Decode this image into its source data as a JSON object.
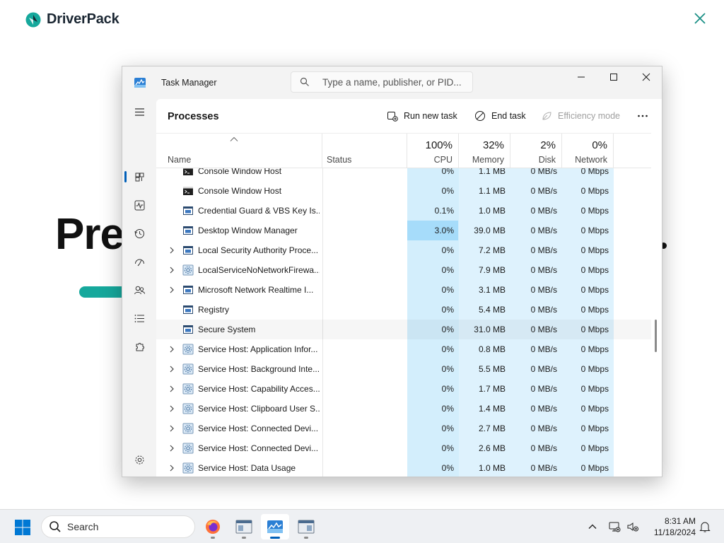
{
  "installer": {
    "brand": "DriverPack",
    "heading_fragment": "Pre"
  },
  "window": {
    "title": "Task Manager",
    "search_placeholder": "Type a name, publisher, or PID..."
  },
  "toolbar": {
    "section_title": "Processes",
    "run_new_task": "Run new task",
    "end_task": "End task",
    "efficiency_mode": "Efficiency mode"
  },
  "columns": {
    "name": "Name",
    "status": "Status",
    "cpu": {
      "percent": "100%",
      "label": "CPU"
    },
    "memory": {
      "percent": "32%",
      "label": "Memory"
    },
    "disk": {
      "percent": "2%",
      "label": "Disk"
    },
    "network": {
      "percent": "0%",
      "label": "Network"
    }
  },
  "processes": [
    {
      "name": "Console Window Host",
      "icon": "console-icon",
      "expandable": false,
      "cpu": "0%",
      "memory": "1.1 MB",
      "disk": "0 MB/s",
      "network": "0 Mbps"
    },
    {
      "name": "Console Window Host",
      "icon": "console-icon",
      "expandable": false,
      "cpu": "0%",
      "memory": "1.1 MB",
      "disk": "0 MB/s",
      "network": "0 Mbps"
    },
    {
      "name": "Credential Guard & VBS Key Is...",
      "icon": "window-icon",
      "expandable": false,
      "cpu": "0.1%",
      "memory": "1.0 MB",
      "disk": "0 MB/s",
      "network": "0 Mbps"
    },
    {
      "name": "Desktop Window Manager",
      "icon": "window-icon",
      "expandable": false,
      "cpu": "3.0%",
      "memory": "39.0 MB",
      "disk": "0 MB/s",
      "network": "0 Mbps",
      "cpu_highlight": true
    },
    {
      "name": "Local Security Authority Proce...",
      "icon": "window-icon",
      "expandable": true,
      "cpu": "0%",
      "memory": "7.2 MB",
      "disk": "0 MB/s",
      "network": "0 Mbps"
    },
    {
      "name": "LocalServiceNoNetworkFirewa...",
      "icon": "gear-icon",
      "expandable": true,
      "cpu": "0%",
      "memory": "7.9 MB",
      "disk": "0 MB/s",
      "network": "0 Mbps"
    },
    {
      "name": "Microsoft Network Realtime I...",
      "icon": "window-icon",
      "expandable": true,
      "cpu": "0%",
      "memory": "3.1 MB",
      "disk": "0 MB/s",
      "network": "0 Mbps"
    },
    {
      "name": "Registry",
      "icon": "window-icon",
      "expandable": false,
      "cpu": "0%",
      "memory": "5.4 MB",
      "disk": "0 MB/s",
      "network": "0 Mbps"
    },
    {
      "name": "Secure System",
      "icon": "window-icon",
      "expandable": false,
      "cpu": "0%",
      "memory": "31.0 MB",
      "disk": "0 MB/s",
      "network": "0 Mbps",
      "hover": true
    },
    {
      "name": "Service Host: Application Infor...",
      "icon": "gear-icon",
      "expandable": true,
      "cpu": "0%",
      "memory": "0.8 MB",
      "disk": "0 MB/s",
      "network": "0 Mbps"
    },
    {
      "name": "Service Host: Background Inte...",
      "icon": "gear-icon",
      "expandable": true,
      "cpu": "0%",
      "memory": "5.5 MB",
      "disk": "0 MB/s",
      "network": "0 Mbps"
    },
    {
      "name": "Service Host: Capability Acces...",
      "icon": "gear-icon",
      "expandable": true,
      "cpu": "0%",
      "memory": "1.7 MB",
      "disk": "0 MB/s",
      "network": "0 Mbps"
    },
    {
      "name": "Service Host: Clipboard User S...",
      "icon": "gear-icon",
      "expandable": true,
      "cpu": "0%",
      "memory": "1.4 MB",
      "disk": "0 MB/s",
      "network": "0 Mbps"
    },
    {
      "name": "Service Host: Connected Devi...",
      "icon": "gear-icon",
      "expandable": true,
      "cpu": "0%",
      "memory": "2.7 MB",
      "disk": "0 MB/s",
      "network": "0 Mbps"
    },
    {
      "name": "Service Host: Connected Devi...",
      "icon": "gear-icon",
      "expandable": true,
      "cpu": "0%",
      "memory": "2.6 MB",
      "disk": "0 MB/s",
      "network": "0 Mbps"
    },
    {
      "name": "Service Host: Data Usage",
      "icon": "gear-icon",
      "expandable": true,
      "cpu": "0%",
      "memory": "1.0 MB",
      "disk": "0 MB/s",
      "network": "0 Mbps"
    }
  ],
  "taskbar": {
    "search_label": "Search",
    "apps": [
      "firefox-icon",
      "app-window-icon",
      "task-manager-icon",
      "app-window-icon"
    ],
    "time": "8:31 AM",
    "date": "11/18/2024"
  },
  "colors": {
    "accent": "#005fb8",
    "cpu_column": "#d3eefc",
    "cpu_highlight": "#a6dcfa",
    "other_columns": "#def2fd",
    "brand_teal": "#16a89c"
  }
}
